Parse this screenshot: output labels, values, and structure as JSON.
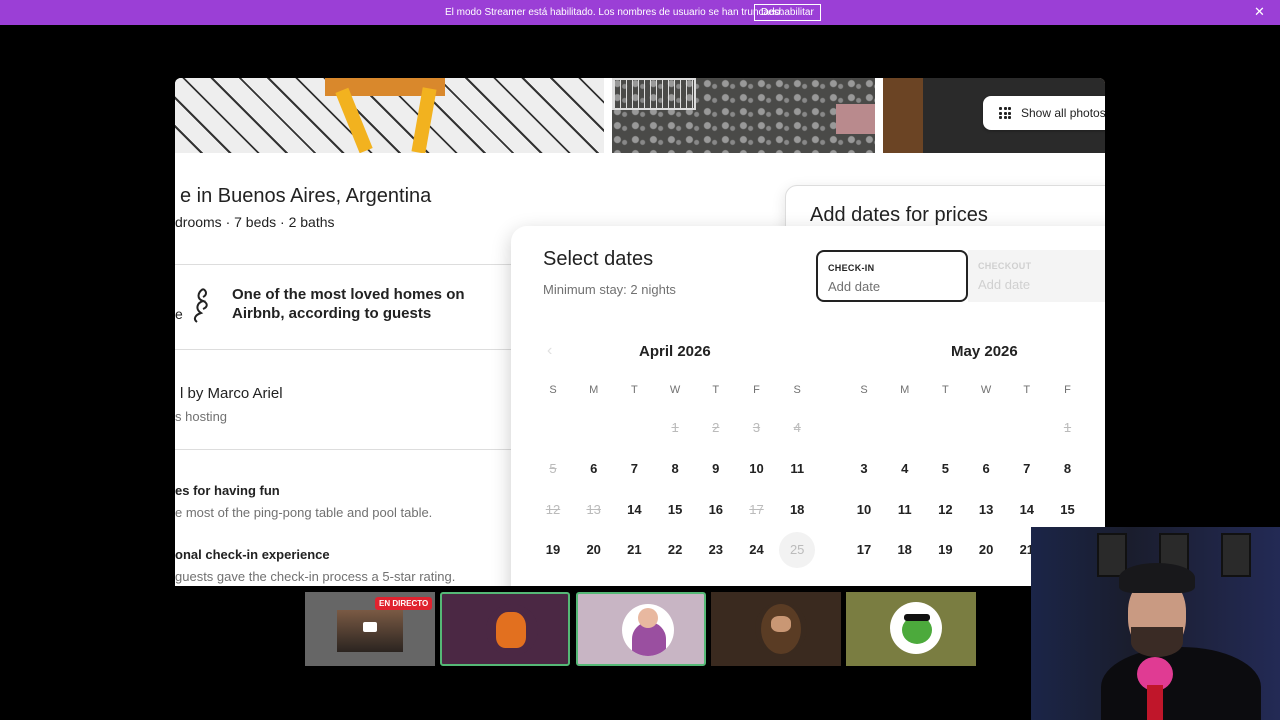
{
  "banner": {
    "message": "El modo Streamer está habilitado. Los nombres de usuario se han truncado.",
    "button": "Deshabilitar",
    "close": "✕",
    "bg_color": "#9b3fd6"
  },
  "listing": {
    "show_all_photos": "Show all photos",
    "title": "e in Buenos Aires, Argentina",
    "subtitle": "drooms · 7 beds · 2 baths",
    "loved_prefix": "e",
    "loved_text": "One of the most loved homes on Airbnb, according to guests",
    "host_name": "l by Marco Ariel",
    "host_years": "s hosting",
    "highlights": [
      {
        "title": "es for having fun",
        "desc": "e most of the ping-pong table and pool table."
      },
      {
        "title": "onal check-in experience",
        "desc": "guests gave the check-in process a 5-star rating."
      }
    ]
  },
  "price_card": {
    "title": "Add dates for prices"
  },
  "date_picker": {
    "title": "Select dates",
    "subtitle": "Minimum stay: 2 nights",
    "checkin_label": "CHECK-IN",
    "checkin_value": "Add date",
    "checkout_label": "CHECKOUT",
    "checkout_value": "Add date",
    "prev_arrow": "‹",
    "weekdays": [
      "S",
      "M",
      "T",
      "W",
      "T",
      "F",
      "S"
    ],
    "months": [
      {
        "name": "April 2026",
        "weeks": [
          [
            {
              "d": ""
            },
            {
              "d": ""
            },
            {
              "d": ""
            },
            {
              "d": "1",
              "s": "dis"
            },
            {
              "d": "2",
              "s": "dis"
            },
            {
              "d": "3",
              "s": "dis"
            },
            {
              "d": "4",
              "s": "dis"
            }
          ],
          [
            {
              "d": "5",
              "s": "dis"
            },
            {
              "d": "6"
            },
            {
              "d": "7"
            },
            {
              "d": "8"
            },
            {
              "d": "9"
            },
            {
              "d": "10"
            },
            {
              "d": "11"
            }
          ],
          [
            {
              "d": "12",
              "s": "dis"
            },
            {
              "d": "13",
              "s": "dis"
            },
            {
              "d": "14"
            },
            {
              "d": "15"
            },
            {
              "d": "16"
            },
            {
              "d": "17",
              "s": "dis"
            },
            {
              "d": "18"
            }
          ],
          [
            {
              "d": "19"
            },
            {
              "d": "20"
            },
            {
              "d": "21"
            },
            {
              "d": "22"
            },
            {
              "d": "23"
            },
            {
              "d": "24"
            },
            {
              "d": "25",
              "s": "today"
            }
          ]
        ]
      },
      {
        "name": "May 2026",
        "weeks": [
          [
            {
              "d": ""
            },
            {
              "d": ""
            },
            {
              "d": ""
            },
            {
              "d": ""
            },
            {
              "d": ""
            },
            {
              "d": "1",
              "s": "dis"
            }
          ],
          [
            {
              "d": "3"
            },
            {
              "d": "4"
            },
            {
              "d": "5"
            },
            {
              "d": "6"
            },
            {
              "d": "7"
            },
            {
              "d": "8"
            }
          ],
          [
            {
              "d": "10"
            },
            {
              "d": "11"
            },
            {
              "d": "12"
            },
            {
              "d": "13"
            },
            {
              "d": "14"
            },
            {
              "d": "15"
            }
          ],
          [
            {
              "d": "17"
            },
            {
              "d": "18"
            },
            {
              "d": "19"
            },
            {
              "d": "20"
            },
            {
              "d": "21"
            }
          ]
        ]
      }
    ]
  },
  "participants": {
    "live_badge": "EN DIRECTO",
    "tiles": [
      {
        "name": "screen-share-tile"
      },
      {
        "name": "participant-tile-orange-character"
      },
      {
        "name": "participant-tile-pink-avatar"
      },
      {
        "name": "participant-tile-bearded-character"
      },
      {
        "name": "participant-tile-frog"
      }
    ]
  }
}
